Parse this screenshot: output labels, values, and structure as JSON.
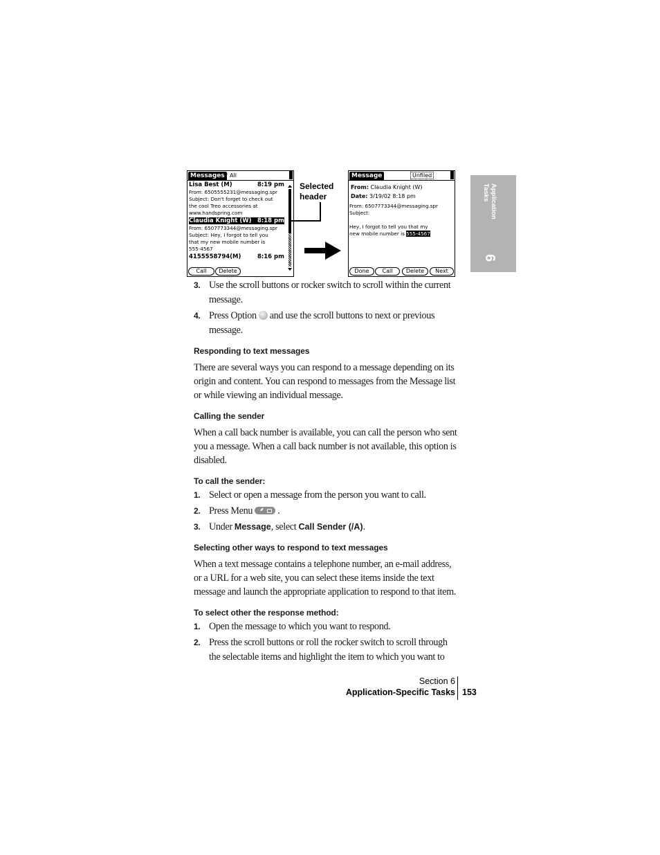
{
  "screenshots": {
    "list": {
      "title": "Messages",
      "category": "All",
      "messages": [
        {
          "sender": "Lisa Best (M)",
          "time": "8:19 pm",
          "lines": [
            "From: 6505555231@messaging.spr",
            "Subject:  Don't forget to check out",
            "the cool Treo accessories at",
            "www.handspring.com"
          ],
          "selected": false
        },
        {
          "sender": "Claudia Knight (W)",
          "time": "8:18 pm",
          "lines": [
            "From: 6507773344@messaging.spr",
            "Subject:  Hey, I forgot to tell you",
            "that my new mobile number is",
            "555-4567"
          ],
          "selected": true
        },
        {
          "sender": "4155558794(M)",
          "time": "8:16 pm",
          "lines": [],
          "selected": false
        }
      ],
      "buttons": [
        "Call",
        "Delete"
      ]
    },
    "detail": {
      "title": "Message",
      "category": "Unfiled",
      "from_label": "From:",
      "from_value": "Claudia Knight (W)",
      "date_label": "Date:",
      "date_value": "3/19/02 8:18 pm",
      "from_line": "From: 6507773344@messaging.spr",
      "subject_line": "Subject:",
      "body_line1": "Hey, I forgot to tell you that my",
      "body_line2_prefix": "new mobile number is ",
      "body_highlight": "555-4567",
      "buttons": [
        "Done",
        "Call",
        "Delete",
        "Next"
      ]
    },
    "callout": {
      "line1": "Selected",
      "line2": "header"
    }
  },
  "side_tab": {
    "label_line1": "Application",
    "label_line2": "Tasks",
    "chapter": "6"
  },
  "content": {
    "steps_top": [
      {
        "num": "3.",
        "text": "Use the scroll buttons or rocker switch to scroll within the current message."
      },
      {
        "num": "4.",
        "text_before": "Press Option",
        "text_after": "and use the scroll buttons to next or previous message."
      }
    ],
    "h_responding": "Responding to text messages",
    "p_responding": "There are several ways you can respond to a message depending on its origin and content. You can respond to messages from the Message list or while viewing an individual message.",
    "h_calling": "Calling the sender",
    "p_calling": "When a call back number is available, you can call the person who sent you a message. When a call back number is not available, this option is disabled.",
    "h_to_call": "To call the sender:",
    "call_steps": [
      {
        "num": "1.",
        "text": "Select or open a message from the person you want to call."
      },
      {
        "num": "2.",
        "text": "Press Menu",
        "after": "."
      },
      {
        "num": "3.",
        "pre": "Under ",
        "b1": "Message",
        "mid": ", select ",
        "b2": "Call Sender (/A)",
        "post": "."
      }
    ],
    "h_selecting": "Selecting other ways to respond to text messages",
    "p_selecting": "When a text message contains a telephone number, an e-mail address, or a URL for a web site, you can select these items inside the text message and launch the appropriate application to respond to that item.",
    "h_to_select": "To select other the response method:",
    "select_steps": [
      {
        "num": "1.",
        "text": "Open the message to which you want to respond."
      },
      {
        "num": "2.",
        "text": "Press the scroll buttons or roll the rocker switch to scroll through the selectable items and highlight the item to which you want to"
      }
    ]
  },
  "footer": {
    "section": "Section 6",
    "title": "Application-Specific Tasks",
    "page": "153"
  }
}
